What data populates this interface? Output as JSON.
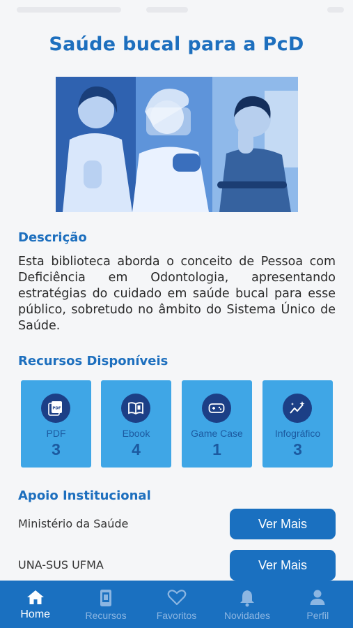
{
  "page": {
    "title": "Saúde bucal para a PcD"
  },
  "description": {
    "heading": "Descrição",
    "text": "Esta biblioteca aborda o conceito de Pessoa com Deficiência em Odontologia, apresentando estratégias do cuidado em saúde bucal para esse público, sobretudo no âmbito do Sistema Único de Saúde."
  },
  "resources": {
    "heading": "Recursos Disponíveis",
    "items": [
      {
        "label": "PDF",
        "count": "3",
        "icon": "pdf-icon"
      },
      {
        "label": "Ebook",
        "count": "4",
        "icon": "book-icon"
      },
      {
        "label": "Game Case",
        "count": "1",
        "icon": "gamepad-icon"
      },
      {
        "label": "Infográfico",
        "count": "3",
        "icon": "chart-sparkle-icon"
      }
    ]
  },
  "support": {
    "heading": "Apoio Institucional",
    "items": [
      {
        "name": "Ministério da Saúde",
        "button": "Ver Mais"
      },
      {
        "name": "UNA-SUS UFMA",
        "button": "Ver Mais"
      }
    ]
  },
  "tabbar": {
    "items": [
      {
        "label": "Home",
        "icon": "home-icon",
        "active": true
      },
      {
        "label": "Recursos",
        "icon": "device-icon",
        "active": false
      },
      {
        "label": "Favoritos",
        "icon": "heart-icon",
        "active": false
      },
      {
        "label": "Novidades",
        "icon": "bell-icon",
        "active": false
      },
      {
        "label": "Perfil",
        "icon": "user-icon",
        "active": false
      }
    ]
  },
  "colors": {
    "primary": "#1d6fbe",
    "card": "#3fa6e6",
    "icon_circle": "#1c3f86",
    "tabbar": "#1a70c0"
  }
}
